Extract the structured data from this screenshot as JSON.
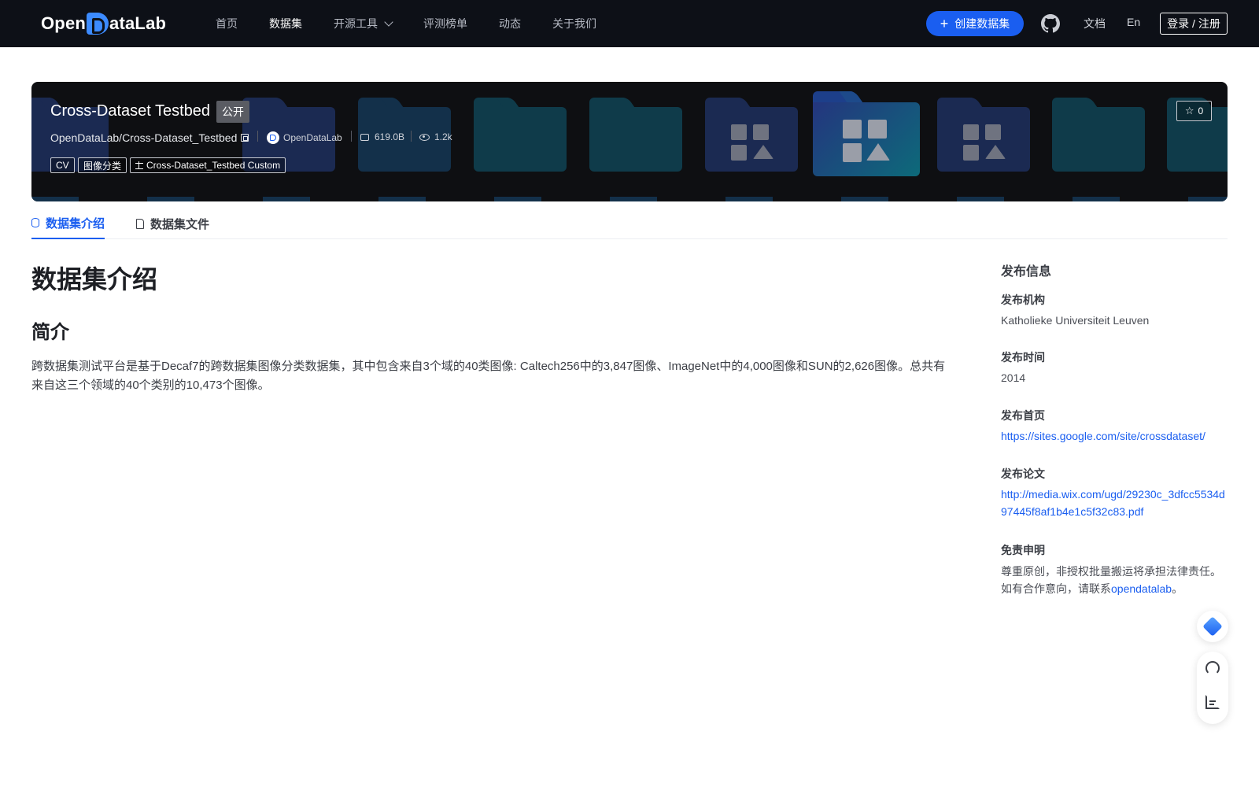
{
  "header": {
    "logo_text": "OpenDataLab",
    "nav": [
      {
        "label": "首页"
      },
      {
        "label": "数据集",
        "active": true
      },
      {
        "label": "开源工具",
        "has_dropdown": true
      },
      {
        "label": "评测榜单"
      },
      {
        "label": "动态"
      },
      {
        "label": "关于我们"
      }
    ],
    "create_button": "创建数据集",
    "docs_link": "文档",
    "lang_link": "En",
    "login_button": "登录 / 注册",
    "icons": {
      "github": "github-icon",
      "plus": "plus-icon",
      "chevron": "chevron-down-icon"
    }
  },
  "banner": {
    "title": "Cross-Dataset Testbed",
    "visibility_badge": "公开",
    "path": "OpenDataLab/Cross-Dataset_Testbed",
    "organization": "OpenDataLab",
    "size": "619.0B",
    "views": "1.2k",
    "tags": [
      "CV",
      "图像分类"
    ],
    "license": "Cross-Dataset_Testbed Custom",
    "stars": "0"
  },
  "tabs": [
    {
      "label": "数据集介绍",
      "icon": "database-icon",
      "active": true
    },
    {
      "label": "数据集文件",
      "icon": "file-icon"
    }
  ],
  "main": {
    "heading": "数据集介绍",
    "section_title": "简介",
    "description": "跨数据集测试平台是基于Decaf7的跨数据集图像分类数据集，其中包含来自3个域的40类图像: Caltech256中的3,847图像、ImageNet中的4,000图像和SUN的2,626图像。总共有来自这三个领域的40个类别的10,473个图像。"
  },
  "sidebar": {
    "title": "发布信息",
    "org_label": "发布机构",
    "org_value": "Katholieke Universiteit Leuven",
    "time_label": "发布时间",
    "time_value": "2014",
    "homepage_label": "发布首页",
    "homepage_value": "https://sites.google.com/site/crossdataset/",
    "paper_label": "发布论文",
    "paper_value": "http://media.wix.com/ugd/29230c_3dfcc5534d97445f8af1b4e1c5f32c83.pdf",
    "disclaimer_label": "免责申明",
    "disclaimer_line1": "尊重原创，非授权批量搬运将承担法律责任。",
    "disclaimer_line2_prefix": "如有合作意向，请联系",
    "disclaimer_link": "opendatalab",
    "disclaimer_suffix": "。"
  },
  "colors": {
    "topbar": "#0d1017",
    "accent": "#1a5ef0",
    "banner_bg": "#0e0f12",
    "folder_teal": "#0f3b4a",
    "folder_navy": "#1b2a52"
  }
}
